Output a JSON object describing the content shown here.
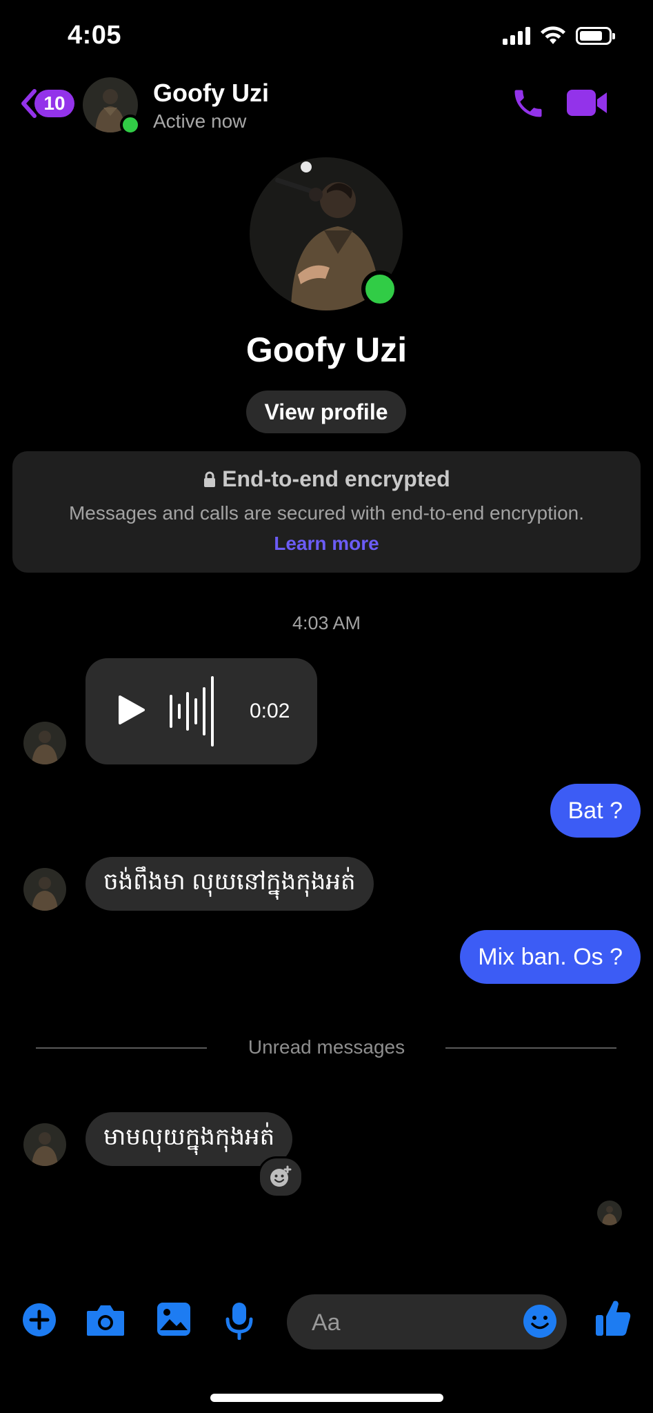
{
  "status_bar": {
    "time": "4:05",
    "battery_level": 0.8
  },
  "header": {
    "unread_count": "10",
    "contact_name": "Goofy Uzi",
    "status": "Active now",
    "icons": {
      "back": "chevron-left-icon",
      "call": "phone-icon",
      "video": "video-camera-icon"
    },
    "accent_color": "#9333ea"
  },
  "profile": {
    "name": "Goofy Uzi",
    "view_profile_label": "View profile"
  },
  "encryption": {
    "title": "End-to-end encrypted",
    "description": "Messages and calls are secured with end-to-end encryption.",
    "link_label": "Learn more"
  },
  "conversation": {
    "timestamp": "4:03 AM",
    "voice_message": {
      "duration": "0:02"
    },
    "messages": [
      {
        "direction": "outgoing",
        "text": "Bat ?"
      },
      {
        "direction": "incoming",
        "text": "ចង់ពឹងមា លុយនៅក្នុងកុងអត់"
      },
      {
        "direction": "outgoing",
        "text": "Mix ban. Os ?"
      },
      {
        "direction": "incoming",
        "text": "មាមលុយក្នុងកុងអត់"
      }
    ],
    "unread_divider": "Unread messages",
    "outgoing_color": "#3c5cf5"
  },
  "composer": {
    "placeholder": "Aa",
    "tools": [
      "plus-icon",
      "camera-icon",
      "image-icon",
      "microphone-icon"
    ],
    "tool_color": "#1d7cf2"
  }
}
